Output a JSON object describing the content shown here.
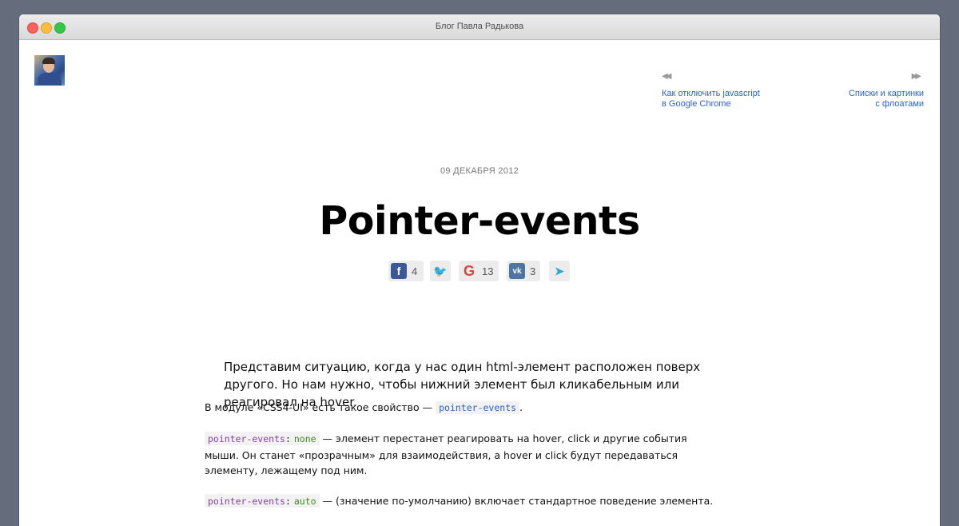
{
  "window": {
    "title": "Блог Павла Радькова"
  },
  "nav": {
    "prev_arrow": "◀◀",
    "prev_line1": "Как отключить javascript",
    "prev_line2": "в Google Chrome",
    "next_arrow": "▶▶",
    "next_line1": "Списки и картинки",
    "next_line2": "с флоатами"
  },
  "post": {
    "date": "09 ДЕКАБРЯ 2012",
    "title": "Pointer-events"
  },
  "share": [
    {
      "icon": "facebook-icon",
      "glyph": "f",
      "color": "#3b5998",
      "count": "4"
    },
    {
      "icon": "twitter-icon",
      "glyph": "🐦",
      "color": "#1da1f2",
      "count": ""
    },
    {
      "icon": "google-icon",
      "glyph": "G",
      "color": "#db4437",
      "count": "13"
    },
    {
      "icon": "vk-icon",
      "glyph": "vk",
      "color": "#4c75a3",
      "count": "3"
    },
    {
      "icon": "telegram-icon",
      "glyph": "➤",
      "color": "#2aa3df",
      "count": ""
    }
  ],
  "article": {
    "lead": "Представим ситуацию, когда у нас один html-элемент расположен поверх другого. Но нам нужно, чтобы нижний элемент был кликабельным или реагировал на hover.",
    "p1_text": "В модуле «CSS4-UI» есть такое свойство — ",
    "p1_code": "pointer-events",
    "p1_end": ".",
    "p2_prop": "pointer-events",
    "p2_colon": ":",
    "p2_value": "none",
    "p2_text": " — элемент перестанет реагировать на hover, click и другие события мыши. Он станет «прозрачным» для взаимодействия, а hover и click будут передаваться элементу, лежащему под ним.",
    "p3_prop": "pointer-events",
    "p3_colon": ":",
    "p3_value": "auto",
    "p3_text": " — (значение по-умолчанию) включает стандартное поведение элемента."
  }
}
